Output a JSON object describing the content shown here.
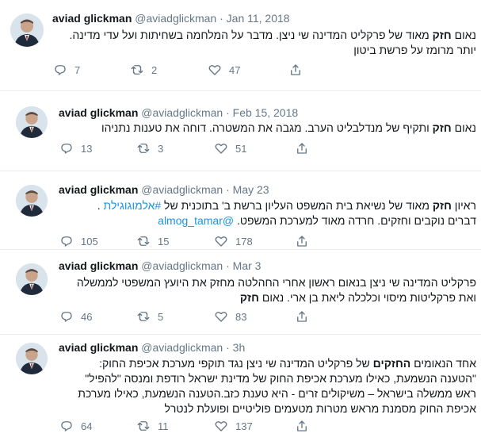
{
  "tweets": [
    {
      "name": "aviad glickman",
      "handle": "@aviadglickman",
      "dot": "·",
      "time": "Jan 11, 2018",
      "lines": [
        {
          "a": "נאום ",
          "b": "חזק",
          "c": " מאוד של פרקליט המדינה שי ניצן. מדבר על המלחמה בשחיתות ועל עדי מדינה."
        },
        {
          "a": "יותר מרומז על פרשת ביטון",
          "b": "",
          "c": ""
        }
      ],
      "replies": "7",
      "retweets": "2",
      "likes": "47"
    },
    {
      "name": "aviad glickman",
      "handle": "@aviadglickman",
      "dot": "·",
      "time": "Feb 15, 2018",
      "lines": [
        {
          "a": "נאום ",
          "b": "חזק",
          "c": " ותקיף של מנדלבליט הערב. מגבה את המשטרה. דוחה את טענות נתניהו"
        }
      ],
      "replies": "13",
      "retweets": "3",
      "likes": "51"
    },
    {
      "name": "aviad glickman",
      "handle": "@aviadglickman",
      "dot": "·",
      "time": "May 23",
      "line1_a": "ראיון ",
      "line1_b": "חזק",
      "line1_c": " מאוד של נשיאת בית המשפט העליון ברשת ב' בתוכנית של ",
      "line1_hashtag": "#אלמוגוגילת",
      "line1_d": " .",
      "line2_a": "דברים נוקבים וחזקים. חרדה מאוד למערכת המשפט. ",
      "line2_mention": "@almog_tamar",
      "replies": "105",
      "retweets": "15",
      "likes": "178"
    },
    {
      "name": "aviad glickman",
      "handle": "@aviadglickman",
      "dot": "·",
      "time": "Mar 3",
      "lines": [
        {
          "a": "פרקליט המדינה שי ניצן בנאום ראשון אחרי החהלטה מחזק את היועץ המשפטי לממשלה",
          "b": "",
          "c": ""
        },
        {
          "a": "ואת פרקליטות מיסוי וכלכלה ליאת בן ארי. נאום ",
          "b": "חזק",
          "c": ""
        }
      ],
      "replies": "46",
      "retweets": "5",
      "likes": "83"
    },
    {
      "name": "aviad glickman",
      "handle": "@aviadglickman",
      "dot": "·",
      "time": "3h",
      "lines": [
        {
          "a": "אחד הנאומים ",
          "b": "החזקים",
          "c": " של פרקליט המדינה שי ניצן נגד תוקפי מערכת אכיפת החוק:"
        },
        {
          "a": "\"הטענה הנשמעת, כאילו מערכת אכיפת החוק של מדינת ישראל רודפת ומנסה \"להפיל\"",
          "b": "",
          "c": ""
        },
        {
          "a": "ראש ממשלה בישראל – משיקולים זרים - היא טענת כזב.הטענה הנשמעת, כאילו מערכת",
          "b": "",
          "c": ""
        },
        {
          "a": "אכיפת החוק מסמנת מראש מטרות מטעמים פוליטיים ופועלת לנטרל",
          "b": "",
          "c": ""
        }
      ],
      "replies": "64",
      "retweets": "11",
      "likes": "137"
    }
  ]
}
